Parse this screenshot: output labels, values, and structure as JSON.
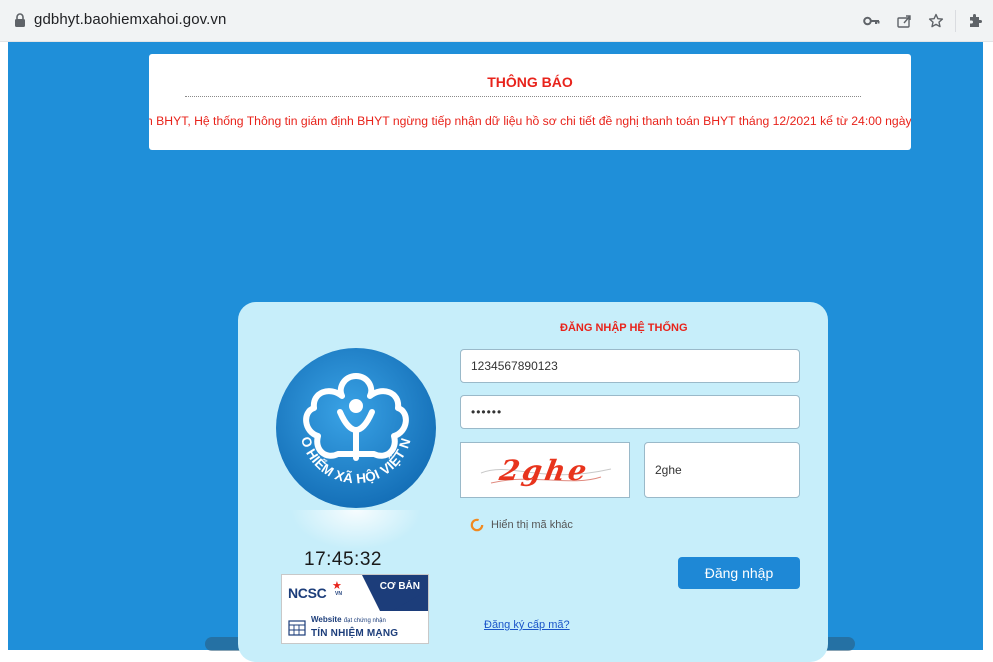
{
  "browser": {
    "url": "gdbhyt.baohiemxahoi.gov.vn",
    "icons": [
      "lock-icon",
      "key-icon",
      "share-icon",
      "star-icon",
      "extensions-icon"
    ]
  },
  "notice": {
    "title": "THÔNG BÁO",
    "message": "h BHYT, Hệ thống Thông tin giám định BHYT ngừng tiếp nhận dữ liệu hồ sơ chi tiết đề nghị thanh toán BHYT tháng 12/2021 kể từ 24:00 ngày"
  },
  "login": {
    "title": "ĐĂNG NHẬP HỆ THỐNG",
    "logo_text": "BẢO HIỂM XÃ HỘI VIỆT NAM",
    "username_value": "1234567890123",
    "password_value": "••••••",
    "captcha_image_text": "2ghe",
    "captcha_input_value": "2ghe",
    "refresh_captcha_label": "Hiển thị mã khác",
    "clock": "17:45:32",
    "submit_label": "Đăng nhập",
    "register_link": "Đăng ký cấp mã?"
  },
  "badge": {
    "brand": "NCSC",
    "brand_suffix": "VN",
    "level": "CƠ BẢN",
    "line1_bold": "Website",
    "line1_small": "đạt chứng nhận",
    "line2": "TÍN NHIỆM MẠNG"
  },
  "colors": {
    "page_background": "#1f8fd9",
    "card_background": "#c7eefa",
    "accent_red": "#e8231b",
    "button_blue": "#1e88d6",
    "logo_blue": "#1a7fc8"
  }
}
